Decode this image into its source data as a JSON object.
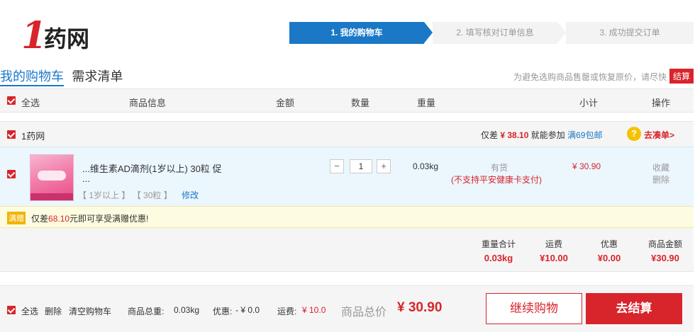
{
  "logo": {
    "text": "1药网"
  },
  "steps": [
    "1. 我的购物车",
    "2. 填写核对订单信息",
    "3. 成功提交订单"
  ],
  "tabs": [
    "我的购物车",
    "需求清单"
  ],
  "notice": "为避免选购商品售罄或恢复原价，请尽快",
  "settle_mini": "结算",
  "table_headers": {
    "select_all": "全选",
    "product_info": "商品信息",
    "amount": "金额",
    "quantity": "数量",
    "weight": "重量",
    "subtotal": "小计",
    "actions": "操作"
  },
  "shop": {
    "name": "1药网",
    "gap_prefix": "仅差",
    "gap_amount": "¥ 38.10",
    "gap_suffix": "就能参加",
    "free_shipping": "满69包邮",
    "go_add": "去凑单>",
    "badge": "?"
  },
  "item": {
    "name_line1": "...维生素AD滴剂(1岁以上) 30粒 促",
    "name_line2": "...",
    "spec1": "【 1岁以上 】",
    "spec2": "【 30粒 】",
    "edit": "修改",
    "quantity": "1",
    "weight": "0.03kg",
    "stock": "有货",
    "stock_note": "(不支持平安健康卡支付)",
    "subtotal": "¥ 30.90",
    "favorite": "收藏",
    "delete": "删除",
    "minus": "−",
    "plus": "+"
  },
  "promo": {
    "tag": "满赠",
    "prefix": "仅差",
    "amount": "68.10",
    "suffix": "元即可享受满赠优惠!"
  },
  "summary": {
    "weight_label": "重量合计",
    "weight_value": "0.03kg",
    "shipping_label": "运费",
    "shipping_value": "¥10.00",
    "discount_label": "优惠",
    "discount_value": "¥0.00",
    "goods_label": "商品金额",
    "goods_value": "¥30.90"
  },
  "footer": {
    "select_all": "全选",
    "delete": "删除",
    "clear": "清空购物车",
    "total_weight_label": "商品总重:",
    "total_weight": "0.03kg",
    "discount_label": "优惠:",
    "discount": "- ¥ 0.0",
    "shipping_label": "运费:",
    "shipping": "¥ 10.0",
    "total_label": "商品总价",
    "total": "¥ 30.90",
    "continue": "继续购物",
    "checkout": "去结算"
  },
  "colors": {
    "brand_blue": "#1a78c6",
    "accent_red": "#d8242b",
    "promo_yellow": "#fdfbe0"
  }
}
